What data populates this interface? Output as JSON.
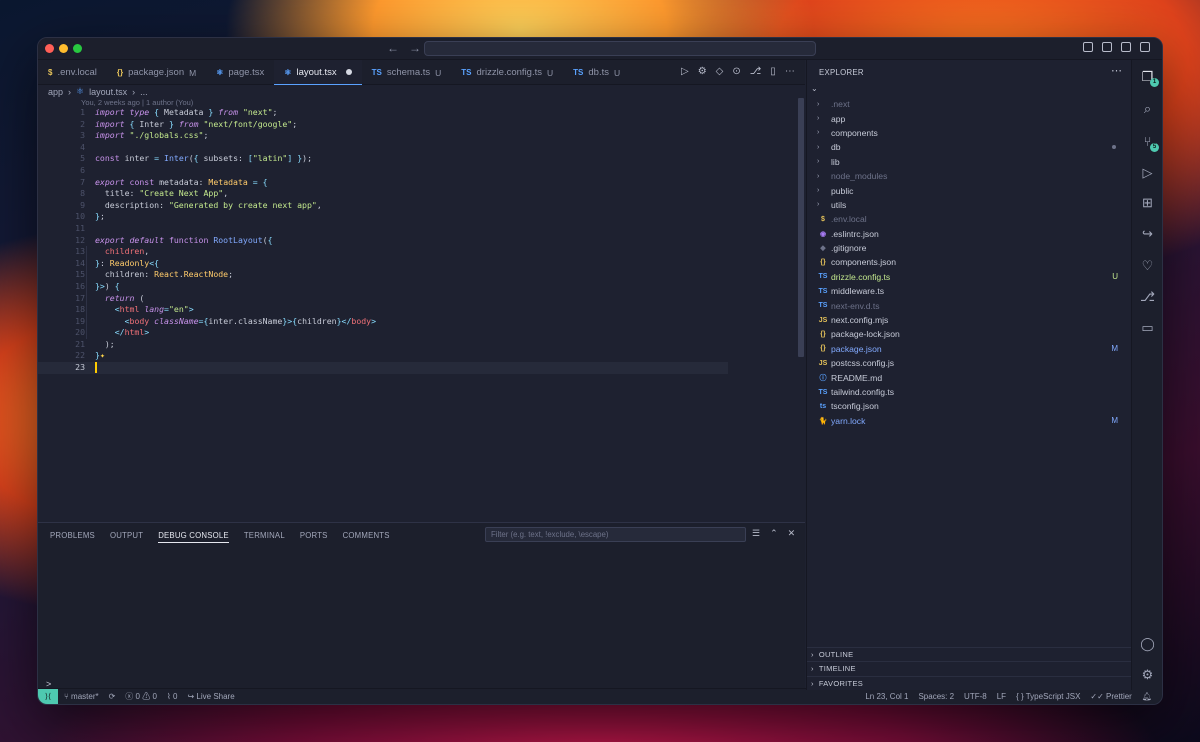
{
  "titlebar": {
    "back_icon": "arrow-left-icon",
    "forward_icon": "arrow-right-icon"
  },
  "tabs": [
    {
      "icon": "$",
      "icon_color": "#e6c35a",
      "label": ".env.local",
      "status": "",
      "active": false
    },
    {
      "icon": "{}",
      "icon_color": "#e6c35a",
      "label": "package.json",
      "status": "M",
      "active": false
    },
    {
      "icon": "⚛",
      "icon_color": "#5aa2ff",
      "label": "page.tsx",
      "status": "",
      "active": false
    },
    {
      "icon": "⚛",
      "icon_color": "#5aa2ff",
      "label": "layout.tsx",
      "status": "",
      "active": true
    },
    {
      "icon": "TS",
      "icon_color": "#5aa2ff",
      "label": "schema.ts",
      "status": "U",
      "active": false
    },
    {
      "icon": "TS",
      "icon_color": "#5aa2ff",
      "label": "drizzle.config.ts",
      "status": "U",
      "active": false
    },
    {
      "icon": "TS",
      "icon_color": "#5aa2ff",
      "label": "db.ts",
      "status": "U",
      "active": false
    }
  ],
  "breadcrumb": {
    "folder": "app",
    "file": "layout.tsx",
    "more": "..."
  },
  "blame": "You, 2 weeks ago | 1 author (You)",
  "code_lines": [
    {
      "n": "1",
      "html": "<span class='k-i'>import type</span> <span class='p'>{</span> Metadata <span class='p'>}</span> <span class='k-i'>from</span> <span class='s'>\"next\"</span>;"
    },
    {
      "n": "2",
      "html": "<span class='k-i'>import</span> <span class='p'>{</span> Inter <span class='p'>}</span> <span class='k-i'>from</span> <span class='s'>\"next/font/google\"</span>;"
    },
    {
      "n": "3",
      "html": "<span class='k-i'>import</span> <span class='s'>\"./globals.css\"</span>;"
    },
    {
      "n": "4",
      "html": ""
    },
    {
      "n": "5",
      "html": "<span class='k'>const</span> inter <span class='p'>=</span> <span class='f'>Inter</span>(<span class='p'>{</span> subsets: <span class='p'>[</span><span class='s'>\"latin\"</span><span class='p'>]</span> <span class='p'>}</span>);"
    },
    {
      "n": "6",
      "html": ""
    },
    {
      "n": "7",
      "html": "<span class='k-i'>export</span> <span class='k'>const</span> metadata: <span class='t'>Metadata</span> <span class='p'>=</span> <span class='p'>{</span>"
    },
    {
      "n": "8",
      "html": "  title: <span class='s'>\"Create Next App\"</span>,"
    },
    {
      "n": "9",
      "html": "  description: <span class='s'>\"Generated by create next app\"</span>,"
    },
    {
      "n": "10",
      "html": "<span class='p'>}</span>;"
    },
    {
      "n": "11",
      "html": ""
    },
    {
      "n": "12",
      "html": "<span class='k-i'>export default</span> <span class='k'>function</span> <span class='f'>RootLayout</span>(<span class='p'>{</span>"
    },
    {
      "n": "13",
      "html": "  <span class='v'>children</span>,"
    },
    {
      "n": "14",
      "html": "<span class='p'>}</span>: <span class='t'>Readonly</span><span class='p'>&lt;{</span>"
    },
    {
      "n": "15",
      "html": "  children: <span class='t'>React</span>.<span class='t'>ReactNode</span>;"
    },
    {
      "n": "16",
      "html": "<span class='p'>}&gt;</span>) <span class='p'>{</span>"
    },
    {
      "n": "17",
      "html": "  <span class='k-i'>return</span> ("
    },
    {
      "n": "18",
      "html": "    <span class='p'>&lt;</span><span class='v'>html</span> <span class='a'>lang</span><span class='p'>=</span><span class='s'>\"en\"</span><span class='p'>&gt;</span>"
    },
    {
      "n": "19",
      "html": "      <span class='p'>&lt;</span><span class='v'>body</span> <span class='a'>className</span><span class='p'>={</span>inter.className<span class='p'>}&gt;{</span>children<span class='p'>}&lt;/</span><span class='v'>body</span><span class='p'>&gt;</span>"
    },
    {
      "n": "20",
      "html": "    <span class='p'>&lt;/</span><span class='v'>html</span><span class='p'>&gt;</span>"
    },
    {
      "n": "21",
      "html": "  );"
    },
    {
      "n": "22",
      "html": "<span class='p'>}</span><span class='spark'>✦</span>"
    },
    {
      "n": "23",
      "html": "<span class='cursor'></span>"
    }
  ],
  "panel": {
    "tabs": [
      "PROBLEMS",
      "OUTPUT",
      "DEBUG CONSOLE",
      "TERMINAL",
      "PORTS",
      "COMMENTS"
    ],
    "active_tab": "DEBUG CONSOLE",
    "filter_placeholder": "Filter (e.g. text, !exclude, \\escape)",
    "prompt": ">"
  },
  "statusbar": {
    "branch": "master*",
    "errors": "0",
    "warnings": "0",
    "ports": "0",
    "live_share": "Live Share",
    "position": "Ln 23, Col 1",
    "spaces": "Spaces: 2",
    "encoding": "UTF-8",
    "eol": "LF",
    "language": "TypeScript JSX",
    "formatter": "Prettier"
  },
  "explorer": {
    "title": "EXPLORER",
    "items": [
      {
        "type": "folder",
        "name": ".next",
        "icon": "",
        "cls": "dim",
        "stat": ""
      },
      {
        "type": "folder",
        "name": "app",
        "icon": "",
        "cls": "",
        "stat": ""
      },
      {
        "type": "folder",
        "name": "components",
        "icon": "",
        "cls": "",
        "stat": ""
      },
      {
        "type": "folder",
        "name": "db",
        "icon": "",
        "cls": "",
        "stat": "dot"
      },
      {
        "type": "folder",
        "name": "lib",
        "icon": "",
        "cls": "",
        "stat": ""
      },
      {
        "type": "folder",
        "name": "node_modules",
        "icon": "",
        "cls": "dim",
        "stat": ""
      },
      {
        "type": "folder",
        "name": "public",
        "icon": "",
        "cls": "",
        "stat": ""
      },
      {
        "type": "folder",
        "name": "utils",
        "icon": "",
        "cls": "",
        "stat": ""
      },
      {
        "type": "file",
        "name": ".env.local",
        "icon": "$",
        "icolor": "#e6c35a",
        "cls": "dim",
        "stat": ""
      },
      {
        "type": "file",
        "name": ".eslintrc.json",
        "icon": "◉",
        "icolor": "#a77bf3",
        "cls": "",
        "stat": ""
      },
      {
        "type": "file",
        "name": ".gitignore",
        "icon": "◆",
        "icolor": "#6d7289",
        "cls": "",
        "stat": ""
      },
      {
        "type": "file",
        "name": "components.json",
        "icon": "{}",
        "icolor": "#e6c35a",
        "cls": "",
        "stat": ""
      },
      {
        "type": "file",
        "name": "drizzle.config.ts",
        "icon": "TS",
        "icolor": "#5aa2ff",
        "cls": "unt",
        "stat": "U"
      },
      {
        "type": "file",
        "name": "middleware.ts",
        "icon": "TS",
        "icolor": "#5aa2ff",
        "cls": "",
        "stat": ""
      },
      {
        "type": "file",
        "name": "next-env.d.ts",
        "icon": "TS",
        "icolor": "#5aa2ff",
        "cls": "dim",
        "stat": ""
      },
      {
        "type": "file",
        "name": "next.config.mjs",
        "icon": "JS",
        "icolor": "#e6c35a",
        "cls": "",
        "stat": ""
      },
      {
        "type": "file",
        "name": "package-lock.json",
        "icon": "{}",
        "icolor": "#e6c35a",
        "cls": "",
        "stat": ""
      },
      {
        "type": "file",
        "name": "package.json",
        "icon": "{}",
        "icolor": "#e6c35a",
        "cls": "mod",
        "stat": "M"
      },
      {
        "type": "file",
        "name": "postcss.config.js",
        "icon": "JS",
        "icolor": "#e6c35a",
        "cls": "",
        "stat": ""
      },
      {
        "type": "file",
        "name": "README.md",
        "icon": "ⓘ",
        "icolor": "#5aa2ff",
        "cls": "",
        "stat": ""
      },
      {
        "type": "file",
        "name": "tailwind.config.ts",
        "icon": "TS",
        "icolor": "#5aa2ff",
        "cls": "",
        "stat": ""
      },
      {
        "type": "file",
        "name": "tsconfig.json",
        "icon": "ts",
        "icolor": "#5aa2ff",
        "cls": "",
        "stat": ""
      },
      {
        "type": "file",
        "name": "yarn.lock",
        "icon": "🐈",
        "icolor": "#5aa2ff",
        "cls": "mod",
        "stat": "M"
      }
    ],
    "sections": [
      "OUTLINE",
      "TIMELINE",
      "FAVORITES"
    ]
  },
  "activity": [
    {
      "name": "explorer-icon",
      "glyph": "❐",
      "badge": "1",
      "active": true
    },
    {
      "name": "search-icon",
      "glyph": "⌕",
      "badge": "",
      "active": false
    },
    {
      "name": "source-control-icon",
      "glyph": "⑂",
      "badge": "5",
      "active": false
    },
    {
      "name": "run-debug-icon",
      "glyph": "▷",
      "badge": "",
      "active": false
    },
    {
      "name": "extensions-icon",
      "glyph": "⊞",
      "badge": "",
      "active": false
    },
    {
      "name": "remote-explorer-icon",
      "glyph": "↪",
      "badge": "",
      "active": false
    },
    {
      "name": "favorites-icon",
      "glyph": "♡",
      "badge": "",
      "active": false
    },
    {
      "name": "gitlens-icon",
      "glyph": "⎇",
      "badge": "",
      "active": false
    },
    {
      "name": "chat-icon",
      "glyph": "▭",
      "badge": "",
      "active": false
    }
  ],
  "activity_bottom": [
    {
      "name": "account-icon",
      "glyph": "◯"
    },
    {
      "name": "settings-gear-icon",
      "glyph": "⚙"
    }
  ]
}
